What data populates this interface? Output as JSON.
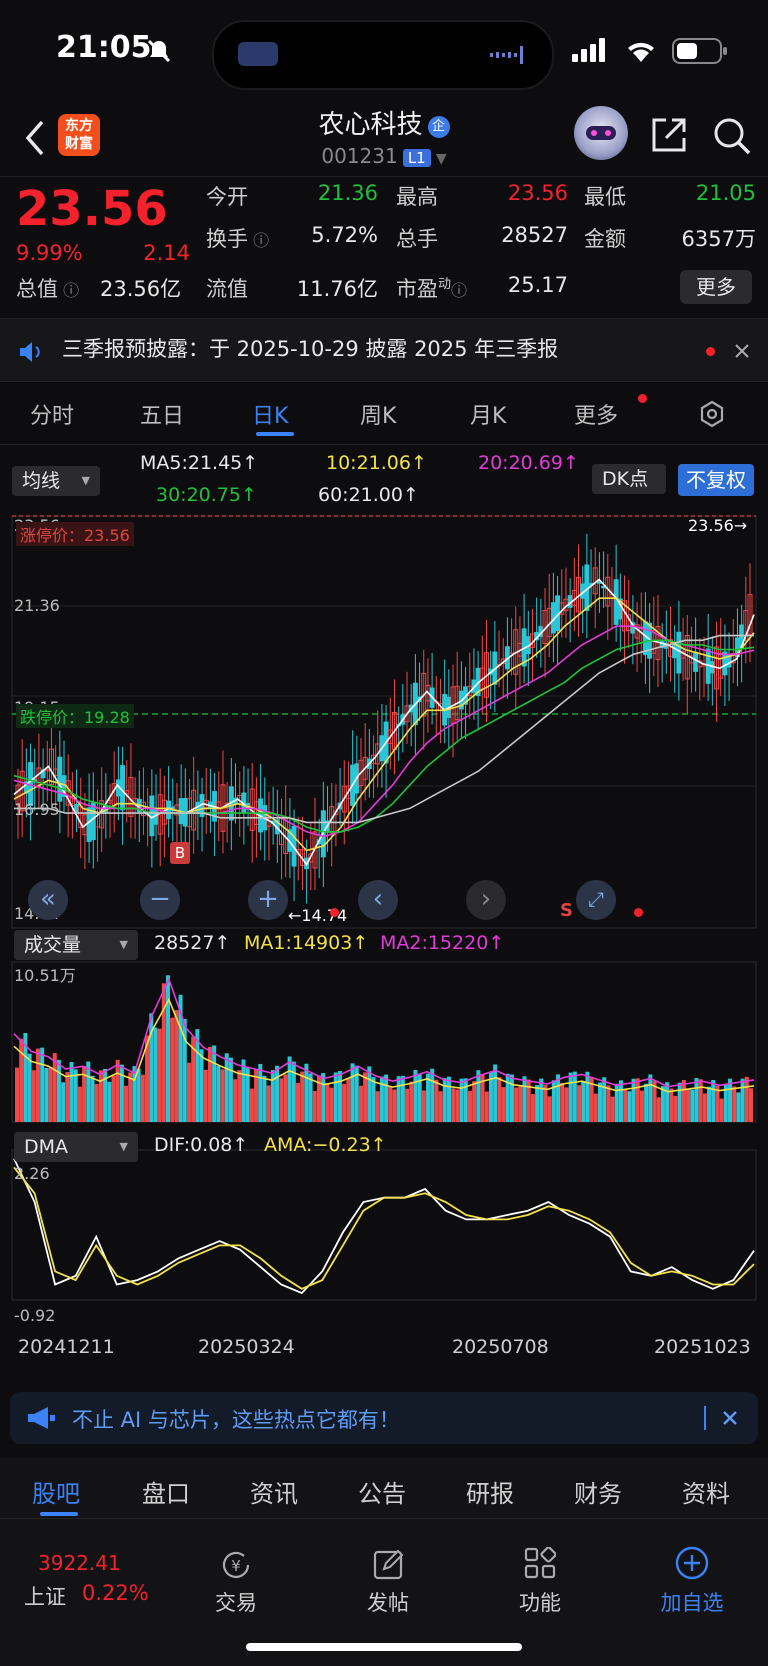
{
  "status_bar": {
    "time": "21:05"
  },
  "header": {
    "logo_text": "东方\n财富",
    "stock_name": "农心科技",
    "stock_badge": "企",
    "stock_code": "001231",
    "level_badge": "L1"
  },
  "quote": {
    "price": "23.56",
    "change_pct": "9.99%",
    "change_amt": "2.14",
    "open_label": "今开",
    "open": "21.36",
    "high_label": "最高",
    "high": "23.56",
    "low_label": "最低",
    "low": "21.05",
    "turnover_label": "换手",
    "turnover": "5.72%",
    "volume_label": "总手",
    "volume": "28527",
    "amount_label": "金额",
    "amount": "6357万",
    "mktcap_label": "总值",
    "mktcap": "23.56亿",
    "float_label": "流值",
    "float": "11.76亿",
    "pe_label": "市盈",
    "pe_sup": "动",
    "pe": "25.17",
    "more_label": "更多"
  },
  "notice": {
    "text": "三季报预披露：于 2025-10-29 披露 2025 年三季报",
    "accent": "#f5222d"
  },
  "tabs": [
    {
      "label": "分时"
    },
    {
      "label": "五日"
    },
    {
      "label": "日K"
    },
    {
      "label": "周K"
    },
    {
      "label": "月K"
    },
    {
      "label": "更多"
    }
  ],
  "ma_bar": {
    "selector": "均线",
    "ma5": "MA5:21.45↑",
    "ma10": "10:21.06↑",
    "ma20": "20:20.69↑",
    "ma30": "30:20.75↑",
    "ma60": "60:21.00↑",
    "dk": "DK点",
    "adjust": "不复权"
  },
  "kline": {
    "ylabels": [
      "23.56",
      "21.36",
      "19.15",
      "16.95",
      "14.74"
    ],
    "limit_up_label": "涨停价：23.56",
    "limit_down_label": "跌停价：19.28",
    "last_price_tag": "23.56→",
    "min_tag": "←14.74",
    "buy_marker": "B",
    "sell_marker": "S"
  },
  "volume": {
    "selector": "成交量",
    "vol": "28527↑",
    "ma1": "MA1:14903↑",
    "ma2": "MA2:15220↑",
    "max_label": "10.51万"
  },
  "dma": {
    "selector": "DMA",
    "dif": "DIF:0.08↑",
    "ama": "AMA:−0.23↑",
    "max_label": "2.26",
    "min_label": "-0.92"
  },
  "dates": [
    "20241211",
    "20250324",
    "20250708",
    "20251023"
  ],
  "hot_banner": {
    "text": "不止 AI 与芯片，这些热点它都有！"
  },
  "subtabs": [
    {
      "label": "股吧"
    },
    {
      "label": "盘口"
    },
    {
      "label": "资讯"
    },
    {
      "label": "公告"
    },
    {
      "label": "研报"
    },
    {
      "label": "财务"
    },
    {
      "label": "资料"
    }
  ],
  "tabbar": {
    "index_value": "3922.41",
    "index_name": "上证",
    "index_pct": "0.22%",
    "trade": "交易",
    "post": "发帖",
    "func": "功能",
    "watch": "加自选"
  },
  "chart_data": [
    {
      "type": "line",
      "title": "",
      "series": [
        {
          "name": "MA5",
          "values": [
            17.6,
            17.9,
            18.2,
            17.6,
            16.9,
            17.2,
            17.8,
            17.4,
            17.1,
            17.3,
            17.2,
            17.4,
            17.3,
            17.5,
            17.2,
            17.0,
            16.6,
            16.1,
            16.8,
            17.4,
            18.0,
            18.4,
            18.9,
            19.4,
            19.8,
            19.4,
            19.6,
            20.0,
            20.3,
            20.6,
            20.8,
            21.2,
            21.6,
            21.9,
            22.2,
            21.8,
            21.2,
            20.9,
            20.8,
            20.6,
            20.4,
            20.3,
            20.5,
            21.45
          ]
        },
        {
          "name": "MA10",
          "values": [
            17.5,
            17.7,
            17.9,
            17.8,
            17.3,
            17.2,
            17.4,
            17.4,
            17.3,
            17.3,
            17.2,
            17.3,
            17.3,
            17.4,
            17.3,
            17.1,
            16.8,
            16.4,
            16.5,
            16.9,
            17.5,
            18.0,
            18.5,
            19.0,
            19.4,
            19.4,
            19.5,
            19.8,
            20.0,
            20.3,
            20.5,
            20.8,
            21.2,
            21.5,
            21.8,
            21.8,
            21.5,
            21.2,
            20.9,
            20.7,
            20.6,
            20.5,
            20.6,
            21.06
          ]
        },
        {
          "name": "MA20",
          "values": [
            17.9,
            17.8,
            17.7,
            17.6,
            17.4,
            17.3,
            17.3,
            17.3,
            17.3,
            17.2,
            17.2,
            17.2,
            17.2,
            17.3,
            17.3,
            17.2,
            17.0,
            16.8,
            16.7,
            16.8,
            17.0,
            17.4,
            17.8,
            18.3,
            18.7,
            19.0,
            19.2,
            19.4,
            19.6,
            19.8,
            20.0,
            20.2,
            20.5,
            20.8,
            21.0,
            21.2,
            21.2,
            21.1,
            20.9,
            20.8,
            20.7,
            20.6,
            20.6,
            20.69
          ]
        },
        {
          "name": "MA30",
          "values": [
            18.0,
            17.9,
            17.8,
            17.7,
            17.5,
            17.4,
            17.3,
            17.3,
            17.2,
            17.2,
            17.2,
            17.2,
            17.2,
            17.2,
            17.2,
            17.2,
            17.1,
            16.9,
            16.8,
            16.8,
            16.9,
            17.1,
            17.4,
            17.8,
            18.2,
            18.5,
            18.8,
            19.0,
            19.2,
            19.4,
            19.6,
            19.8,
            20.0,
            20.3,
            20.5,
            20.7,
            20.8,
            20.9,
            20.9,
            20.8,
            20.8,
            20.7,
            20.7,
            20.75
          ]
        },
        {
          "name": "MA60",
          "values": [
            17.3,
            17.3,
            17.3,
            17.2,
            17.2,
            17.2,
            17.2,
            17.2,
            17.2,
            17.2,
            17.2,
            17.2,
            17.1,
            17.1,
            17.1,
            17.1,
            17.1,
            17.0,
            17.0,
            17.0,
            17.0,
            17.1,
            17.2,
            17.3,
            17.5,
            17.7,
            17.9,
            18.1,
            18.4,
            18.7,
            19.0,
            19.3,
            19.6,
            19.9,
            20.2,
            20.4,
            20.6,
            20.7,
            20.8,
            20.9,
            20.9,
            21.0,
            21.0,
            21.0
          ]
        }
      ],
      "ylim": [
        14.74,
        23.56
      ]
    },
    {
      "type": "bar",
      "title": "",
      "values": [
        6.5,
        5.2,
        4.8,
        3.9,
        4.1,
        3.5,
        4.2,
        3.6,
        7.8,
        10.51,
        6.9,
        5.5,
        4.8,
        4.2,
        3.9,
        3.6,
        4.4,
        3.8,
        3.2,
        3.5,
        4.1,
        3.4,
        3.0,
        3.3,
        3.7,
        3.1,
        2.9,
        3.4,
        3.8,
        3.2,
        3.0,
        2.8,
        3.3,
        3.5,
        3.1,
        2.7,
        2.9,
        3.2,
        2.6,
        2.8,
        3.0,
        2.7,
        2.9,
        3.1
      ],
      "ylim": [
        0,
        10.51
      ]
    },
    {
      "type": "line",
      "title": "",
      "series": [
        {
          "name": "DIF",
          "values": [
            2.2,
            1.2,
            -0.7,
            -0.5,
            0.4,
            -0.7,
            -0.6,
            -0.4,
            -0.1,
            0.1,
            0.3,
            0.1,
            -0.3,
            -0.7,
            -0.9,
            -0.4,
            0.5,
            1.2,
            1.3,
            1.3,
            1.5,
            1.0,
            0.8,
            0.8,
            0.9,
            1.0,
            1.2,
            0.9,
            0.7,
            0.4,
            -0.4,
            -0.5,
            -0.3,
            -0.6,
            -0.8,
            -0.6,
            0.08
          ]
        },
        {
          "name": "AMA",
          "values": [
            2.0,
            1.4,
            -0.4,
            -0.6,
            0.2,
            -0.5,
            -0.7,
            -0.5,
            -0.2,
            0.0,
            0.2,
            0.2,
            -0.1,
            -0.5,
            -0.8,
            -0.6,
            0.2,
            1.0,
            1.3,
            1.3,
            1.4,
            1.2,
            0.9,
            0.8,
            0.8,
            0.9,
            1.1,
            1.0,
            0.8,
            0.5,
            -0.2,
            -0.5,
            -0.4,
            -0.5,
            -0.7,
            -0.7,
            -0.23
          ]
        }
      ],
      "ylim": [
        -0.92,
        2.26
      ]
    }
  ]
}
